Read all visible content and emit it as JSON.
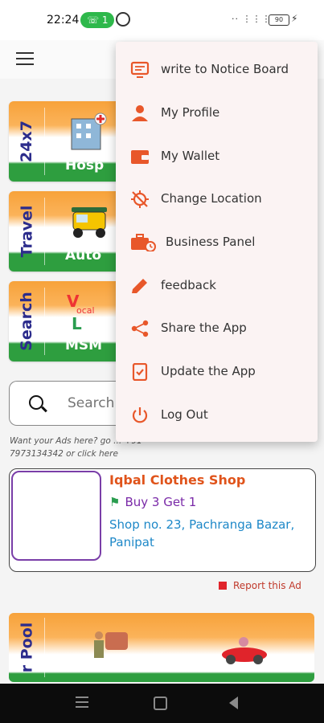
{
  "status_bar": {
    "time": "22:24",
    "call_count": "1",
    "battery": "90",
    "signal": "·· ⋮⋮⋮"
  },
  "tiles": [
    {
      "vertical": "24x7",
      "caption": "Hosp"
    },
    {
      "vertical": "Travel",
      "caption": "Auto"
    },
    {
      "vertical": "Search",
      "caption": "MSM"
    }
  ],
  "search": {
    "placeholder": "Search"
  },
  "ads_note": "Want your Ads here? go ... +91-7973134342 or click here",
  "ad": {
    "name": "Iqbal Clothes Shop",
    "offer": "Buy 3 Get 1",
    "address": "Shop no. 23, Pachranga Bazar, Panipat"
  },
  "report_label": "Report this Ad",
  "carpool_label": "r Pool",
  "menu": [
    {
      "label": "write to Notice Board",
      "icon": "notice-board-icon"
    },
    {
      "label": "My Profile",
      "icon": "person-icon"
    },
    {
      "label": "My Wallet",
      "icon": "wallet-icon"
    },
    {
      "label": "Change Location",
      "icon": "location-off-icon"
    },
    {
      "label": "Business Panel",
      "icon": "briefcase-icon"
    },
    {
      "label": "feedback",
      "icon": "pencil-icon"
    },
    {
      "label": "Share the App",
      "icon": "share-icon"
    },
    {
      "label": "Update the App",
      "icon": "update-icon"
    },
    {
      "label": "Log Out",
      "icon": "power-icon"
    }
  ],
  "colors": {
    "accent": "#e8572a",
    "tile_label": "#2c2c8c",
    "ad_name": "#e0541b",
    "offer": "#7a2aa8",
    "address": "#1e88c8"
  }
}
